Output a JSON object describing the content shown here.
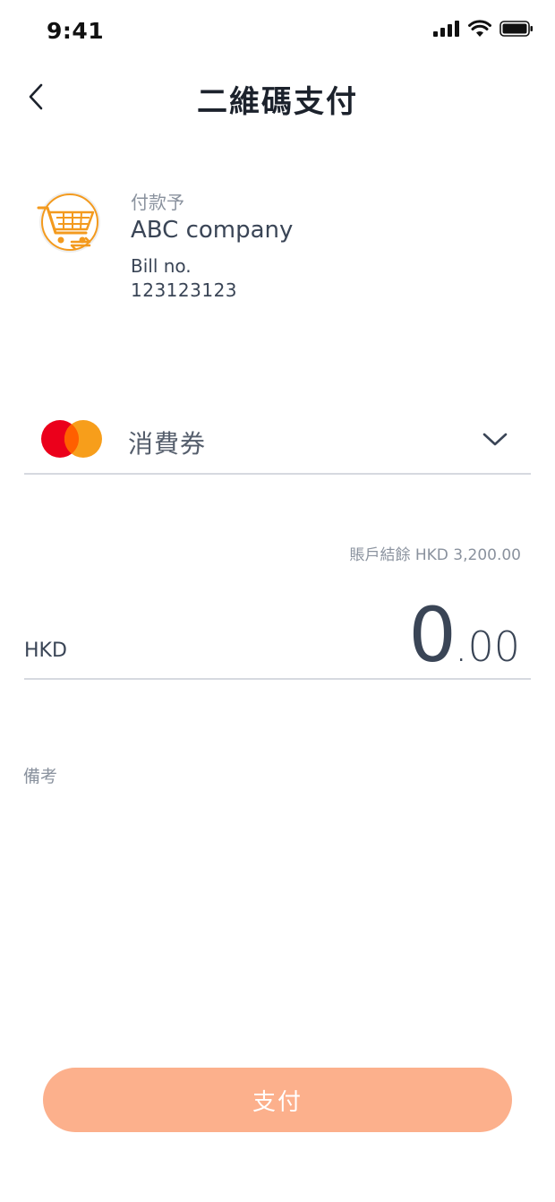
{
  "status_bar": {
    "time": "9:41",
    "icons": [
      "signal-icon",
      "wifi-icon",
      "battery-icon"
    ]
  },
  "header": {
    "back_icon": "chevron-left-icon",
    "title": "二維碼支付"
  },
  "merchant": {
    "logo_icon": "shopping-cart-icon",
    "payee_label": "付款予",
    "name": "ABC company",
    "bill_label": "Bill no.",
    "bill_number": "123123123"
  },
  "payment_method": {
    "card_icon": "mastercard-icon",
    "label": "消費券",
    "dropdown_icon": "chevron-down-icon"
  },
  "balance": {
    "text": "賬戶結餘 HKD 3,200.00"
  },
  "amount": {
    "currency": "HKD",
    "integer": "0",
    "decimal": ".00"
  },
  "remark": {
    "label": "備考"
  },
  "pay_button": {
    "label": "支付"
  },
  "colors": {
    "accent": "#fcb08c",
    "logo_orange": "#f39a1e",
    "mastercard_red": "#eb001b",
    "mastercard_orange": "#f79e1b"
  }
}
